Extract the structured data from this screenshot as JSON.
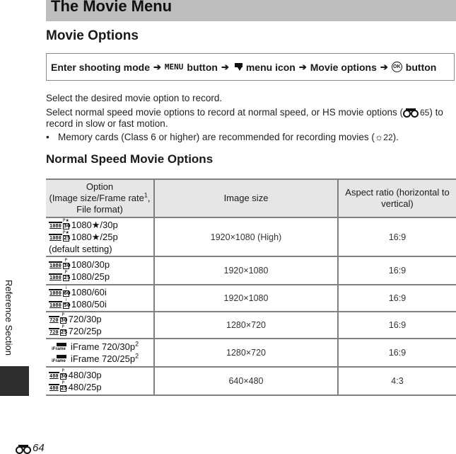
{
  "section_title": "The Movie Menu",
  "heading": "Movie Options",
  "path": {
    "steps": [
      "Enter shooting mode",
      "MENU",
      "button",
      "menu icon",
      "Movie options",
      "button"
    ],
    "arrow": "➔",
    "menu_word": "MENU",
    "icons": [
      "movie-camera-icon",
      "ok-button-icon"
    ]
  },
  "paragraphs": {
    "p1": "Select the desired movie option to record.",
    "p2_before": "Select normal speed movie options to record at normal speed, or HS movie options (",
    "p2_ref": "65",
    "p2_after": ") to record in slow or fast motion.",
    "bullet_before": "Memory cards (Class 6 or higher) are recommended for recording movies (",
    "bullet_ref": "22",
    "bullet_after": ")."
  },
  "subheading": "Normal Speed Movie Options",
  "table": {
    "headers": {
      "option_line1": "Option",
      "option_line2": "(Image size/Frame rate",
      "option_sup": "1",
      "option_line3": ", File format)",
      "image_size": "Image size",
      "aspect": "Aspect ratio (horizontal to vertical)"
    },
    "rows": [
      {
        "options": [
          {
            "badge": "1080",
            "rate_top": "P★",
            "rate": "30",
            "label": "1080★/30p"
          },
          {
            "badge": "1080",
            "rate_top": "P★",
            "rate": "25",
            "label": "1080★/25p"
          }
        ],
        "note": "(default setting)",
        "image_size": "1920×1080 (High)",
        "aspect": "16:9"
      },
      {
        "options": [
          {
            "badge": "1080",
            "rate_top": "P",
            "rate": "30",
            "label": "1080/30p"
          },
          {
            "badge": "1080",
            "rate_top": "P",
            "rate": "25",
            "label": "1080/25p"
          }
        ],
        "image_size": "1920×1080",
        "aspect": "16:9"
      },
      {
        "options": [
          {
            "badge": "1080",
            "rate_top": "i",
            "rate": "60",
            "label": "1080/60i"
          },
          {
            "badge": "1080",
            "rate_top": "i",
            "rate": "50",
            "label": "1080/50i"
          }
        ],
        "image_size": "1920×1080",
        "aspect": "16:9"
      },
      {
        "options": [
          {
            "badge": "720",
            "rate_top": "P",
            "rate": "30",
            "label": "720/30p"
          },
          {
            "badge": "720",
            "rate_top": "P",
            "rate": "25",
            "label": "720/25p"
          }
        ],
        "image_size": "1280×720",
        "aspect": "16:9"
      },
      {
        "options": [
          {
            "badge": "iFrame",
            "label": "iFrame 720/30p",
            "sup": "2"
          },
          {
            "badge": "iFrame",
            "label": "iFrame 720/25p",
            "sup": "2"
          }
        ],
        "image_size": "1280×720",
        "aspect": "16:9"
      },
      {
        "options": [
          {
            "badge": "480",
            "rate_top": "P",
            "rate": "30",
            "label": "480/30p"
          },
          {
            "badge": "480",
            "rate_top": "P",
            "rate": "25",
            "label": "480/25p"
          }
        ],
        "image_size": "640×480",
        "aspect": "4:3"
      }
    ]
  },
  "side_label": "Reference Section",
  "page_number": "64",
  "colors": {
    "section_bar": "#bdbdbd",
    "table_header_bg": "#e6e6e6",
    "table_border": "#808080",
    "side_tab": "#2e2e2e"
  }
}
